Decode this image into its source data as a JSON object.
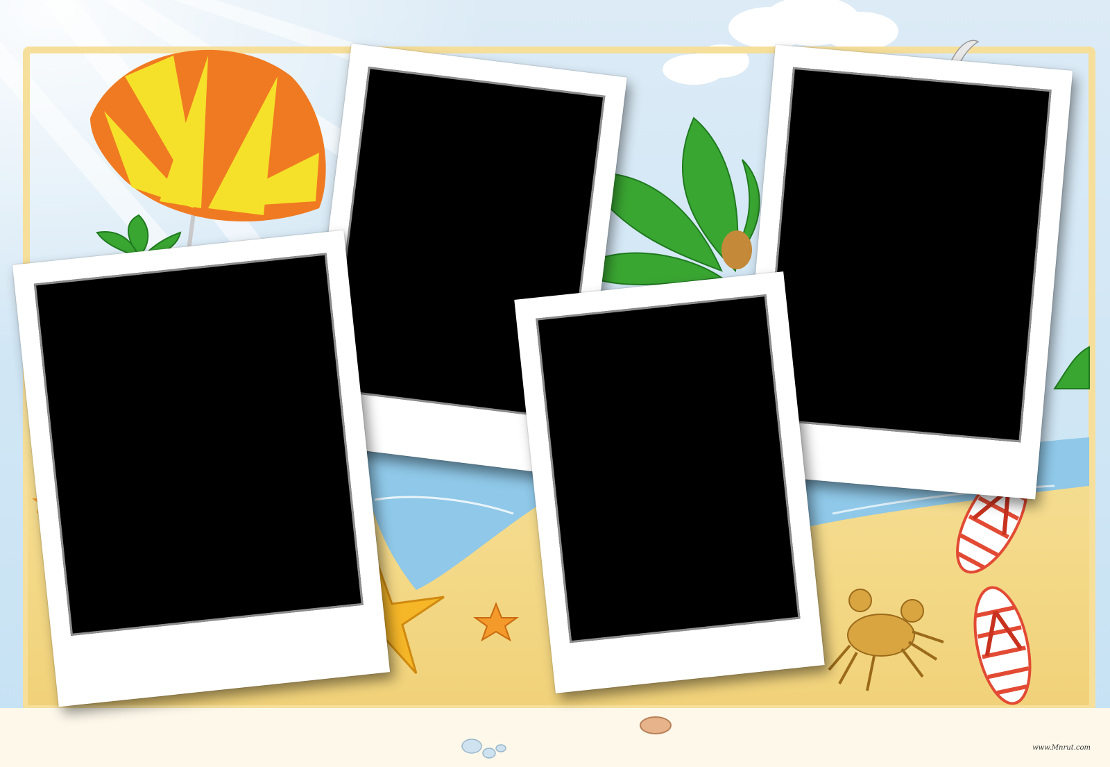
{
  "scene": {
    "theme": "beach-photo-collage-frame",
    "colors": {
      "sky": "#cfe6f6",
      "sand": "#f4dd8a",
      "sea": "#8fc8e8",
      "umbrella_orange": "#f07a22",
      "umbrella_yellow": "#f6e12a",
      "palm_green": "#3aa632",
      "starfish": "#f5b628",
      "flipflop_red": "#e24a34",
      "crab": "#d8a540"
    },
    "photo_slots": 4,
    "decorations": [
      "beach-umbrella",
      "palm-tree",
      "starfish",
      "crab",
      "flip-flops",
      "seagull",
      "pebbles",
      "shell"
    ]
  },
  "watermark": {
    "text": "www.Mnrut.com"
  }
}
